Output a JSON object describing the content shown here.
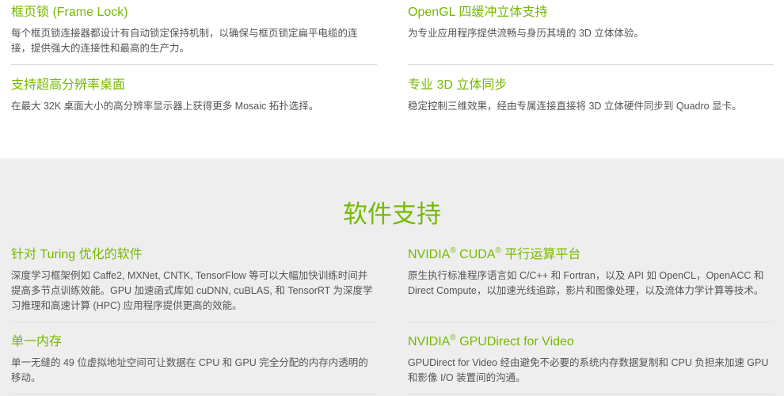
{
  "hardware": {
    "features": [
      {
        "title": "框页锁 (Frame Lock)",
        "description": "每个框页锁连接器都设计有自动锁定保持机制，以确保与框页锁定扁平电缆的连接，提供强大的连接性和最高的生产力。"
      },
      {
        "title": "OpenGL 四缓冲立体支持",
        "description": "为专业应用程序提供流畅与身历其境的 3D 立体体验。"
      },
      {
        "title": "支持超高分辨率桌面",
        "description": "在最大 32K 桌面大小的高分辨率显示器上获得更多 Mosaic 拓扑选择。"
      },
      {
        "title": "专业 3D 立体同步",
        "description": "稳定控制三维效果，经由专属连接直接将 3D 立体硬件同步到 Quadro 显卡。"
      }
    ]
  },
  "software": {
    "section_title": "软件支持",
    "reg_mark": "®",
    "features": [
      {
        "title": "针对 Turing 优化的软件",
        "description": "深度学习框架例如 Caffe2, MXNet, CNTK, TensorFlow 等可以大幅加快训练时间并提高多节点训练效能。GPU 加速函式库如 cuDNN, cuBLAS, 和 TensorRT 为深度学习推理和高速计算 (HPC) 应用程序提供更高的效能。"
      },
      {
        "title_prefix": "NVIDIA",
        "title_middle": " CUDA",
        "title_suffix": " 平行运算平台",
        "description": "原生执行标准程序语言如 C/C++ 和 Fortran，以及 API 如 OpenCL，OpenACC 和 Direct Compute，以加速光线追踪，影片和图像处理，以及流体力学计算等技术。"
      },
      {
        "title": "单一内存",
        "description": "单一无缝的 49 位虚拟地址空间可让数据在 CPU 和 GPU 完全分配的内存内透明的移动。"
      },
      {
        "title_prefix": "NVIDIA",
        "title_suffix": " GPUDirect for Video",
        "description": "GPUDirect for Video 经由避免不必要的系统内存数据复制和 CPU 负担来加速 GPU 和影像 I/O 装置间的沟通。"
      }
    ]
  },
  "colors": {
    "accent": "#76b900",
    "body_text": "#555555",
    "section_background": "#eeeeee"
  }
}
